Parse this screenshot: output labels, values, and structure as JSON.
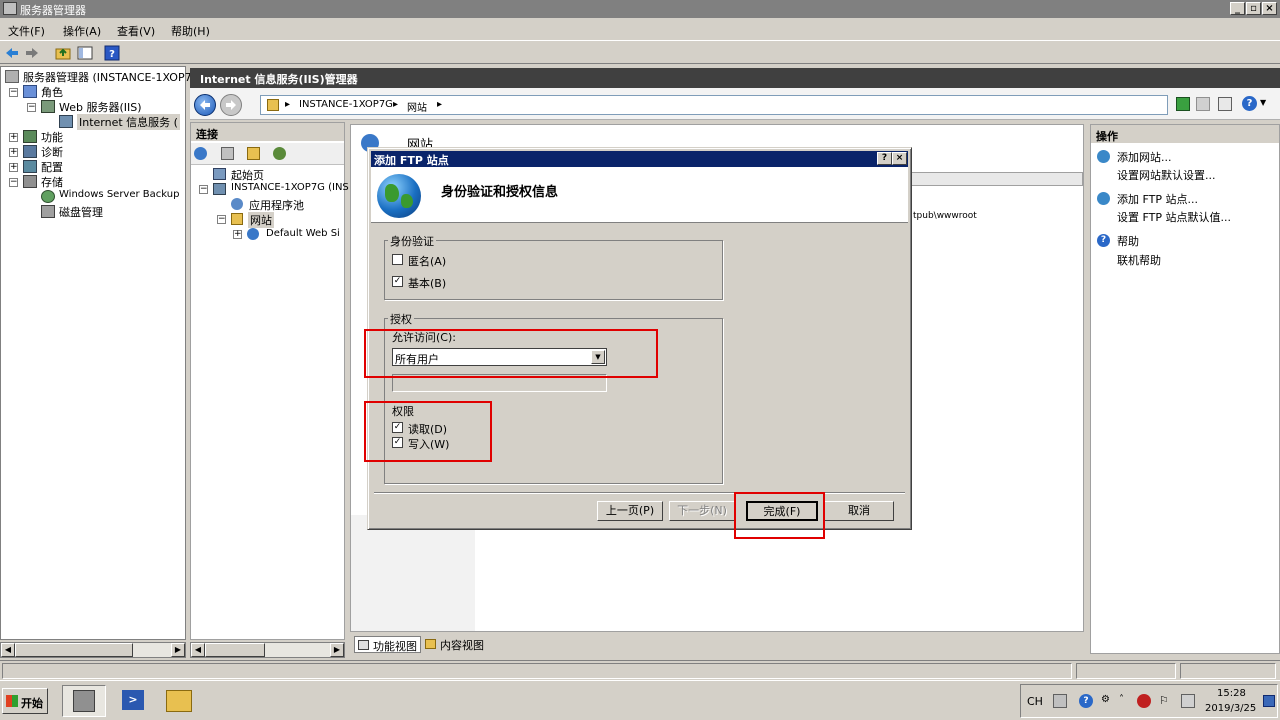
{
  "window": {
    "title": "服务器管理器"
  },
  "menu": [
    "文件(F)",
    "操作(A)",
    "查看(V)",
    "帮助(H)"
  ],
  "tree": {
    "root": "服务器管理器 (INSTANCE-1XOP7",
    "roles": "角色",
    "web_server": "Web 服务器(IIS)",
    "iis": "Internet 信息服务 (",
    "features": "功能",
    "diagnostics": "诊断",
    "config": "配置",
    "storage": "存储",
    "backup": "Windows Server Backup",
    "disk": "磁盘管理"
  },
  "iis": {
    "title": "Internet 信息服务(IIS)管理器",
    "breadcrumb": [
      "INSTANCE-1XOP7G",
      "网站"
    ]
  },
  "connections": {
    "header": "连接",
    "items": [
      "起始页",
      "INSTANCE-1XOP7G (INS",
      "应用程序池",
      "网站",
      "Default Web Si"
    ]
  },
  "center": {
    "heading": "网站",
    "path_fragment": "tpub\\wwwroot",
    "tabs": [
      "功能视图",
      "内容视图"
    ]
  },
  "actions": {
    "header": "操作",
    "items": [
      "添加网站...",
      "设置网站默认设置...",
      "添加 FTP 站点...",
      "设置 FTP 站点默认值...",
      "帮助",
      "联机帮助"
    ]
  },
  "dialog": {
    "title": "添加 FTP 站点",
    "heading": "身份验证和授权信息",
    "auth_group": "身份验证",
    "anonymous": "匿名(A)",
    "anonymous_checked": false,
    "basic": "基本(B)",
    "basic_checked": true,
    "authz_group": "授权",
    "allow_label": "允许访问(C):",
    "allow_value": "所有用户",
    "perm_label": "权限",
    "read": "读取(D)",
    "read_checked": true,
    "write": "写入(W)",
    "write_checked": true,
    "btn_prev": "上一页(P)",
    "btn_next": "下一步(N)",
    "btn_finish": "完成(F)",
    "btn_cancel": "取消",
    "check_mark": "✓"
  },
  "taskbar": {
    "start": "开始",
    "lang": "CH",
    "time": "15:28",
    "date": "2019/3/25"
  },
  "colors": {
    "dialog_title": "#0a246a",
    "highlight": "#e00000",
    "header_dark": "#404040"
  }
}
